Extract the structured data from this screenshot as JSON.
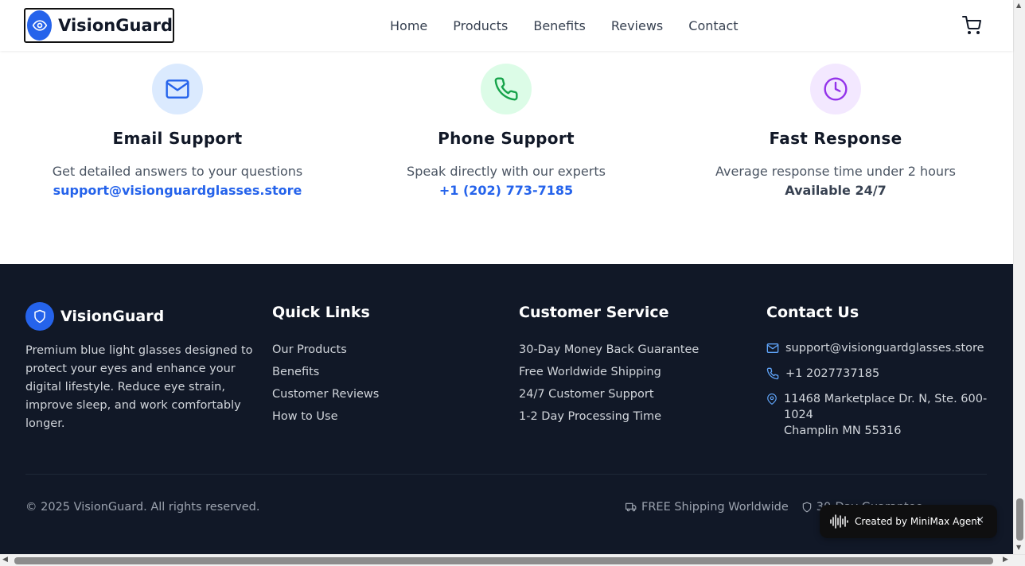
{
  "header": {
    "logo_text": "VisionGuard",
    "nav": [
      "Home",
      "Products",
      "Benefits",
      "Reviews",
      "Contact"
    ],
    "cart_icon": "shopping-cart-icon"
  },
  "support": [
    {
      "icon": "mail-icon",
      "title": "Email Support",
      "desc": "Get detailed answers to your questions",
      "detail": "support@visionguardglasses.store",
      "accent": "#2563eb",
      "bg": "#dbeafe"
    },
    {
      "icon": "phone-icon",
      "title": "Phone Support",
      "desc": "Speak directly with our experts",
      "detail": "+1 (202) 773-7185",
      "accent": "#16a34a",
      "bg": "#dcfce7"
    },
    {
      "icon": "clock-icon",
      "title": "Fast Response",
      "desc": "Average response time under 2 hours",
      "detail": "Available 24/7",
      "accent": "#9333ea",
      "bg": "#f3e8ff"
    }
  ],
  "footer": {
    "brand": "VisionGuard",
    "description": "Premium blue light glasses designed to protect your eyes and enhance your digital lifestyle. Reduce eye strain, improve sleep, and work comfortably longer.",
    "quick_links": {
      "title": "Quick Links",
      "items": [
        "Our Products",
        "Benefits",
        "Customer Reviews",
        "How to Use"
      ]
    },
    "customer_service": {
      "title": "Customer Service",
      "items": [
        "30-Day Money Back Guarantee",
        "Free Worldwide Shipping",
        "24/7 Customer Support",
        "1-2 Day Processing Time"
      ]
    },
    "contact": {
      "title": "Contact Us",
      "email": "support@visionguardglasses.store",
      "phone": "+1 2027737185",
      "address_line1": "11468 Marketplace Dr. N, Ste. 600-1024",
      "address_line2": "Champlin MN 55316"
    },
    "copyright": "© 2025 VisionGuard. All rights reserved.",
    "badges": [
      "FREE Shipping Worldwide",
      "30-Day Guarantee"
    ],
    "bg_color": "#111827"
  },
  "toast": {
    "label": "Created by MiniMax Agent",
    "close": "×"
  }
}
